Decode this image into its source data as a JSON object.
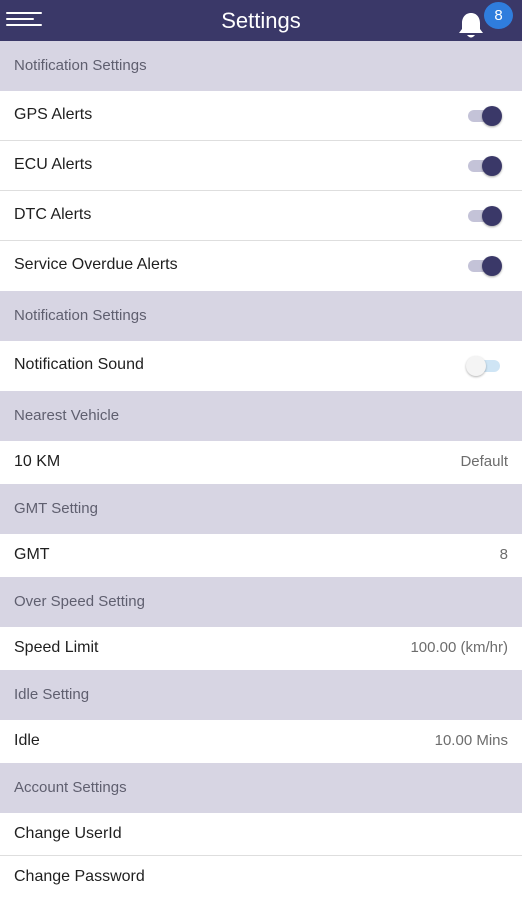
{
  "header": {
    "title": "Settings",
    "notification_count": "8",
    "menu_icon": "hamburger-menu-icon",
    "bell_icon": "bell-icon"
  },
  "colors": {
    "appbar": "#3a3868",
    "section_header": "#d7d5e3",
    "toggle_on": "#3a3868",
    "badge": "#2f7ddd"
  },
  "notification_settings": {
    "header": "Notification Settings",
    "alerts": [
      {
        "label": "GPS Alerts",
        "enabled": true
      },
      {
        "label": "ECU Alerts",
        "enabled": true
      },
      {
        "label": "DTC Alerts",
        "enabled": true
      },
      {
        "label": "Service Overdue Alerts",
        "enabled": true
      }
    ]
  },
  "sound_settings": {
    "header": "Notification Settings",
    "label": "Notification Sound",
    "enabled": false
  },
  "nearest_vehicle": {
    "header": "Nearest Vehicle",
    "label": "10 KM",
    "value": "Default"
  },
  "gmt_setting": {
    "header": "GMT Setting",
    "label": "GMT",
    "value": "8"
  },
  "over_speed_setting": {
    "header": "Over Speed Setting",
    "label": "Speed Limit",
    "value": "100.00 (km/hr)"
  },
  "idle_setting": {
    "header": "Idle Setting",
    "label": "Idle",
    "value": "10.00 Mins"
  },
  "account_settings": {
    "header": "Account Settings",
    "items": [
      "Change UserId",
      "Change Password"
    ]
  }
}
